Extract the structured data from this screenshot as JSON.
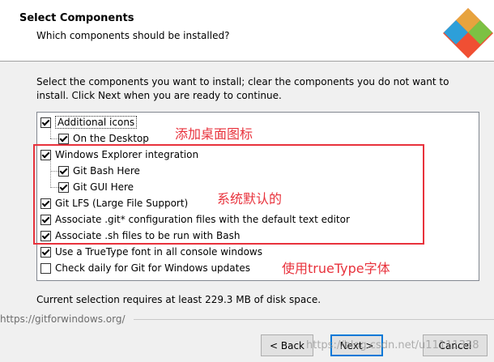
{
  "header": {
    "title": "Select Components",
    "subtitle": "Which components should be installed?"
  },
  "description": "Select the components you want to install; clear the components you do not want to install. Click Next when you are ready to continue.",
  "components": [
    {
      "label": "Additional icons",
      "checked": true
    },
    {
      "label": "On the Desktop",
      "checked": true
    },
    {
      "label": "Windows Explorer integration",
      "checked": true
    },
    {
      "label": "Git Bash Here",
      "checked": true
    },
    {
      "label": "Git GUI Here",
      "checked": true
    },
    {
      "label": "Git LFS (Large File Support)",
      "checked": true
    },
    {
      "label": "Associate .git* configuration files with the default text editor",
      "checked": true
    },
    {
      "label": "Associate .sh files to be run with Bash",
      "checked": true
    },
    {
      "label": "Use a TrueType font in all console windows",
      "checked": true
    },
    {
      "label": "Check daily for Git for Windows updates",
      "checked": false
    }
  ],
  "annotations": {
    "desktop": "添加桌面图标",
    "default": "系统默认的",
    "truetype": "使用trueType字体"
  },
  "requirement": "Current selection requires at least 229.3 MB of disk space.",
  "url": "https://gitforwindows.org/",
  "buttons": {
    "back": "< Back",
    "next": "Next >",
    "cancel": "Cancel"
  },
  "watermark": "https://blog.csdn.net/u11111338",
  "colors": {
    "annotation": "#e8323c",
    "default_button_border": "#0078d7"
  },
  "icons": {
    "logo": "git-logo-icon"
  }
}
